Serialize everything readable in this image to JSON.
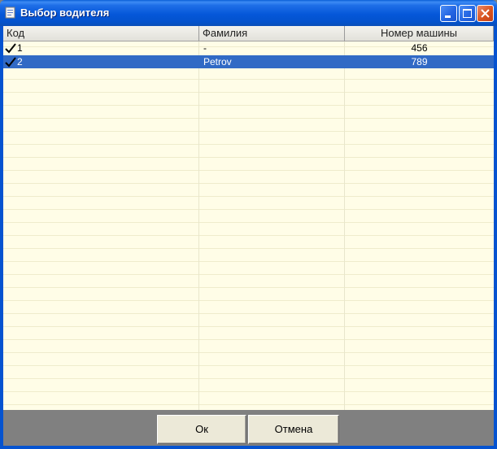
{
  "window": {
    "title": "Выбор водителя"
  },
  "grid": {
    "columns": [
      "Код",
      "Фамилия",
      "Номер машины"
    ],
    "rows": [
      {
        "code": "1",
        "surname": "-",
        "car_number": "456",
        "checked": true,
        "selected": false
      },
      {
        "code": "2",
        "surname": "Petrov",
        "car_number": "789",
        "checked": true,
        "selected": true
      }
    ]
  },
  "buttons": {
    "ok": "Ок",
    "cancel": "Отмена"
  },
  "colors": {
    "titlebar": "#0557d9",
    "grid_bg": "#fffde7",
    "selection": "#316ac5",
    "button_face": "#ece9d8"
  },
  "icons": {
    "app": "window-app-icon",
    "minimize": "minimize-icon",
    "maximize": "maximize-icon",
    "close": "close-icon",
    "check": "checkmark-icon"
  }
}
